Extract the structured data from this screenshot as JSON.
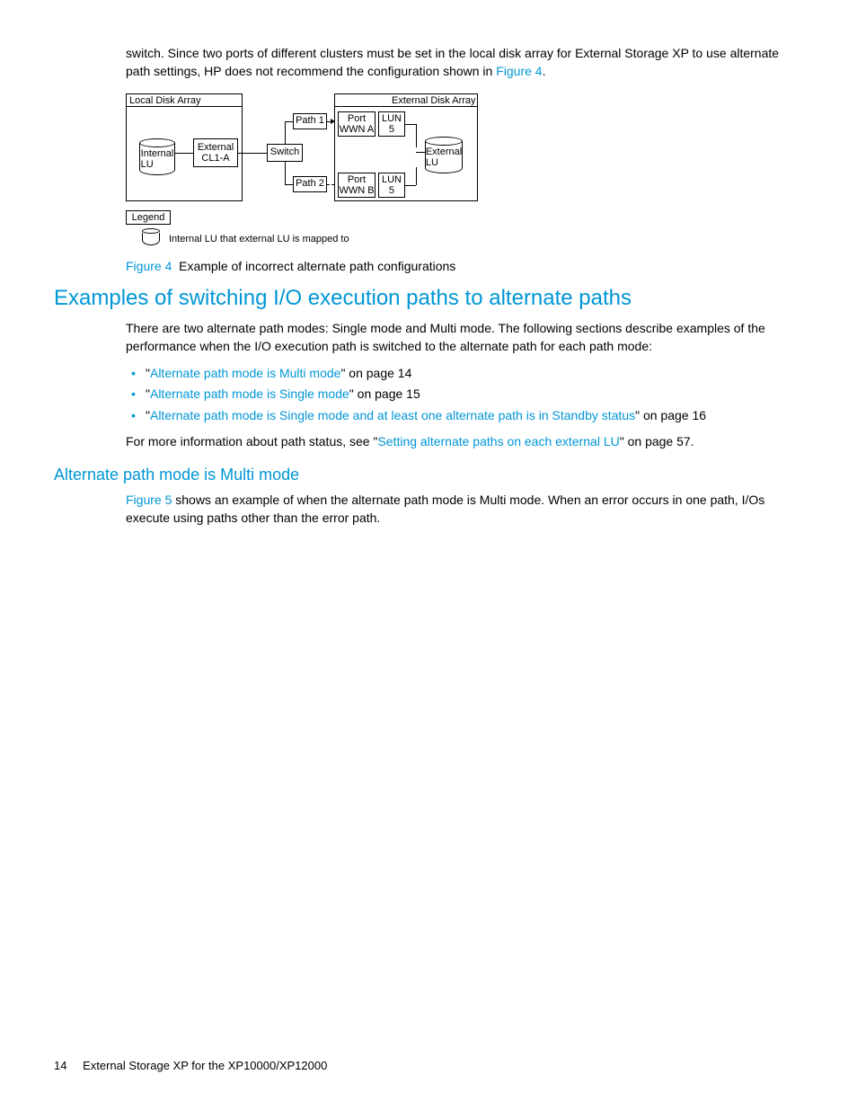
{
  "top_para_prefix": "switch. Since two ports of different clusters must be set in the local disk array for External Storage XP to use alternate path settings, HP does not recommend the configuration shown in ",
  "top_para_link": "Figure 4",
  "top_para_suffix": ".",
  "diagram": {
    "local_title": "Local Disk Array",
    "external_title": "External Disk Array",
    "internal_lu": "Internal\nLU",
    "cl1a": "External\nCL1-A",
    "switch": "Switch",
    "path1": "Path 1",
    "path2": "Path 2",
    "port_wwn_a": "Port\nWWN A",
    "port_wwn_b": "Port\nWWN B",
    "lun5_a": "LUN\n5",
    "lun5_b": "LUN\n5",
    "external_lu": "External\nLU",
    "legend_title": "Legend",
    "legend_text": "Internal LU that external LU is mapped to"
  },
  "figure4": {
    "label": "Figure 4",
    "caption": "Example of incorrect alternate path configurations"
  },
  "section_heading": "Examples of switching I/O execution paths to alternate paths",
  "intro_para": "There are two alternate path modes: Single mode and Multi mode. The following sections describe examples of the performance when the I/O execution path is switched to the alternate path for each path mode:",
  "bullets": [
    {
      "q1": "\"",
      "link": "Alternate path mode is Multi mode",
      "q2": "\" on page 14"
    },
    {
      "q1": "\"",
      "link": "Alternate path mode is Single mode",
      "q2": "\" on page 15"
    },
    {
      "q1": "\"",
      "link": "Alternate path mode is Single mode and at least one alternate path is in Standby status",
      "q2": "\" on page 16"
    }
  ],
  "more_info_prefix": "For more information about path status, see \"",
  "more_info_link": "Setting alternate paths on each external LU",
  "more_info_suffix": "\" on page 57.",
  "subsection_heading": "Alternate path mode is Multi mode",
  "sub_para_link": "Figure 5",
  "sub_para_text": " shows an example of when the alternate path mode is Multi mode. When an error occurs in one path, I/Os execute using paths other than the error path.",
  "footer": {
    "page": "14",
    "title": "External Storage XP for the XP10000/XP12000"
  }
}
